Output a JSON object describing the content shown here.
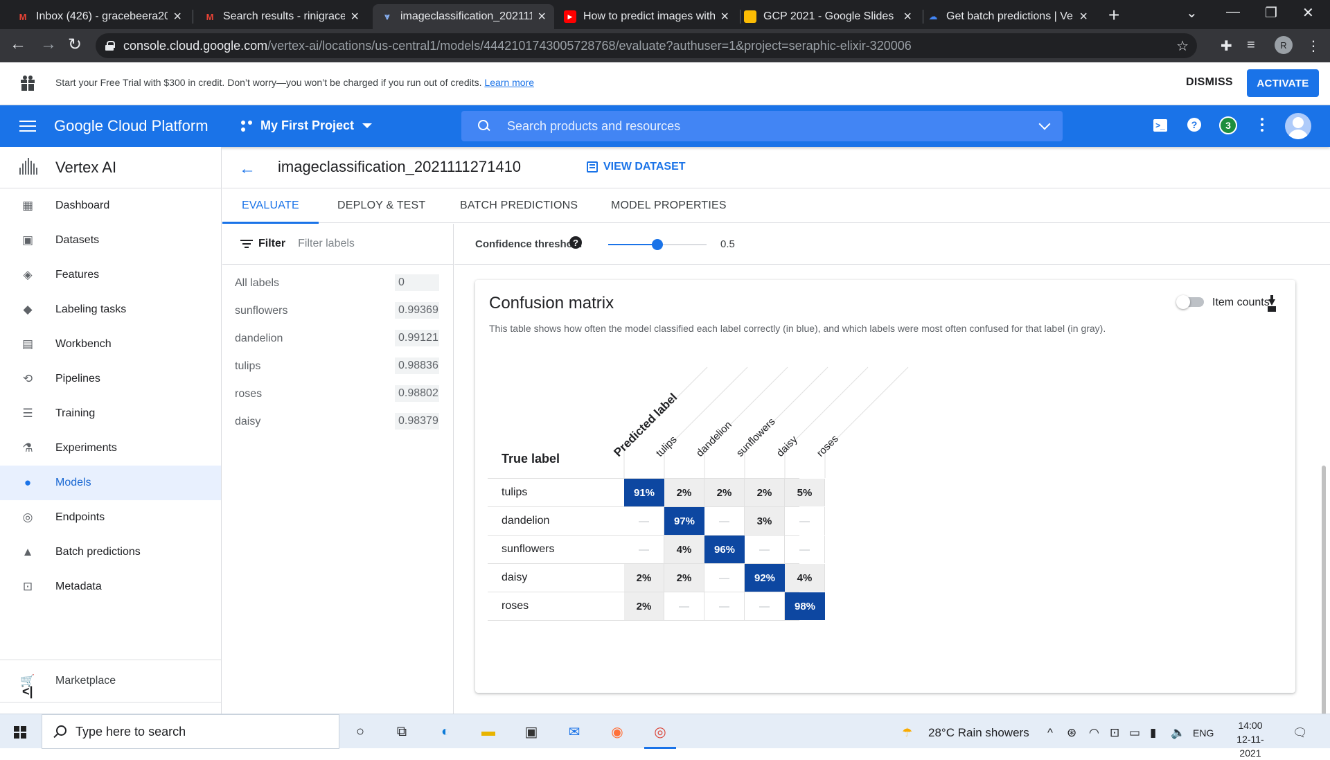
{
  "browser": {
    "tabs": [
      {
        "title": "Inbox (426) - gracebeera20",
        "icon": "gmail-icon"
      },
      {
        "title": "Search results - rinigracebe",
        "icon": "gmail-icon"
      },
      {
        "title": "imageclassification_202111",
        "icon": "vertex-icon"
      },
      {
        "title": "How to predict images with",
        "icon": "youtube-icon"
      },
      {
        "title": "GCP 2021 - Google Slides",
        "icon": "slides-icon"
      },
      {
        "title": "Get batch predictions | Ve",
        "icon": "cloud-icon"
      }
    ],
    "url_host": "console.cloud.google.com",
    "url_path": "/vertex-ai/locations/us-central1/models/4442101743005728768/evaluate?authuser=1&project=seraphic-elixir-320006",
    "profile_initial": "R"
  },
  "banner": {
    "message": "Start your Free Trial with $300 in credit. Don’t worry—you won’t be charged if you run out of credits.",
    "link": "Learn more",
    "dismiss": "DISMISS",
    "activate": "ACTIVATE"
  },
  "header": {
    "brand": "Google Cloud Platform",
    "project": "My First Project",
    "search_placeholder": "Search products and resources",
    "notifications": "3"
  },
  "sidebar": {
    "product": "Vertex AI",
    "items": [
      {
        "label": "Dashboard",
        "icon": "dashboard-icon",
        "glyph": "▦"
      },
      {
        "label": "Datasets",
        "icon": "datasets-icon",
        "glyph": "▣"
      },
      {
        "label": "Features",
        "icon": "features-icon",
        "glyph": "◈"
      },
      {
        "label": "Labeling tasks",
        "icon": "label-icon",
        "glyph": "◆"
      },
      {
        "label": "Workbench",
        "icon": "workbench-icon",
        "glyph": "▤"
      },
      {
        "label": "Pipelines",
        "icon": "pipelines-icon",
        "glyph": "⟲"
      },
      {
        "label": "Training",
        "icon": "training-icon",
        "glyph": "☰"
      },
      {
        "label": "Experiments",
        "icon": "experiments-icon",
        "glyph": "⚗"
      },
      {
        "label": "Models",
        "icon": "models-icon",
        "glyph": "●"
      },
      {
        "label": "Endpoints",
        "icon": "endpoints-icon",
        "glyph": "◎"
      },
      {
        "label": "Batch predictions",
        "icon": "bell-icon",
        "glyph": "▲"
      },
      {
        "label": "Metadata",
        "icon": "metadata-icon",
        "glyph": "⊡"
      }
    ],
    "active_index": 8,
    "marketplace": "Marketplace",
    "collapse": "<|"
  },
  "main": {
    "model_title": "imageclassification_2021111271410",
    "view_dataset": "VIEW DATASET",
    "tabs": [
      "EVALUATE",
      "DEPLOY & TEST",
      "BATCH PREDICTIONS",
      "MODEL PROPERTIES"
    ],
    "active_tab": 0,
    "filter_label": "Filter",
    "filter_placeholder": "Filter labels",
    "labels": [
      {
        "name": "All labels",
        "value": "0"
      },
      {
        "name": "sunflowers",
        "value": "0.99369"
      },
      {
        "name": "dandelion",
        "value": "0.99121"
      },
      {
        "name": "tulips",
        "value": "0.98836"
      },
      {
        "name": "roses",
        "value": "0.98802"
      },
      {
        "name": "daisy",
        "value": "0.98379"
      }
    ],
    "threshold_label": "Confidence threshold",
    "threshold_value": "0.5",
    "threshold_fraction": 0.5
  },
  "confusion_matrix": {
    "title": "Confusion matrix",
    "description": "This table shows how often the model classified each label correctly (in blue), and which labels were most often confused for that label (in gray).",
    "item_counts_label": "Item counts",
    "true_label_header": "True label",
    "predicted_label_header": "Predicted label",
    "labels": [
      "tulips",
      "dandelion",
      "sunflowers",
      "daisy",
      "roses"
    ],
    "cells": [
      [
        "91%",
        "2%",
        "2%",
        "2%",
        "5%"
      ],
      [
        "—",
        "97%",
        "—",
        "3%",
        "—"
      ],
      [
        "—",
        "4%",
        "96%",
        "—",
        "—"
      ],
      [
        "2%",
        "2%",
        "—",
        "92%",
        "4%"
      ],
      [
        "2%",
        "—",
        "—",
        "—",
        "98%"
      ]
    ],
    "colors": {
      "diagonal": "#0d47a1",
      "off_diagonal": "#eeeeee"
    }
  },
  "taskbar": {
    "search_text": "Type here to search",
    "weather": "28°C  Rain showers",
    "lang": "ENG",
    "time": "14:00",
    "date": "12-11-2021"
  }
}
